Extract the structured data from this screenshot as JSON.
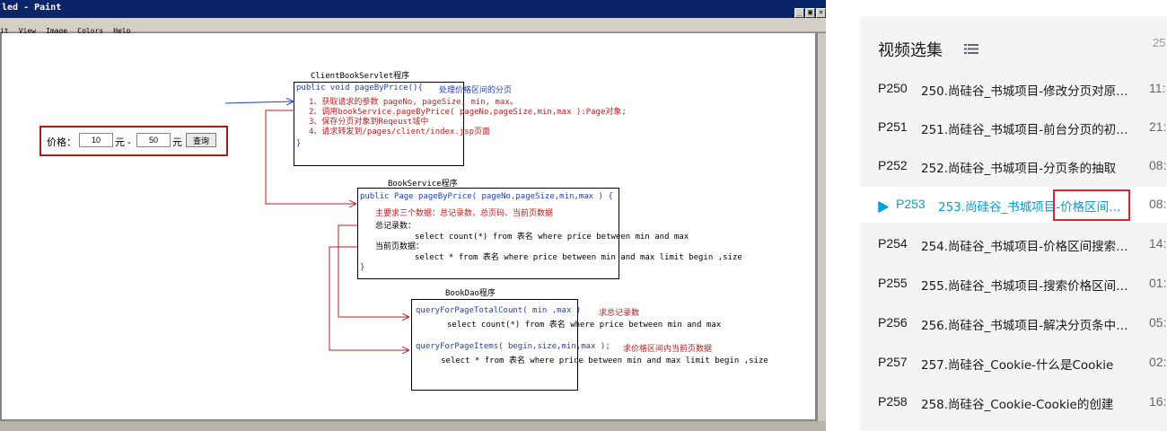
{
  "paint": {
    "title": "led - Paint",
    "menu": [
      "it",
      "View",
      "Image",
      "Colors",
      "Help"
    ],
    "window_buttons": [
      "_",
      "▣",
      "×"
    ]
  },
  "diagram": {
    "price_filter": {
      "label": "价格：",
      "min_value": "10",
      "unit1": "元 -",
      "max_value": "50",
      "unit2": "元",
      "button": "查询"
    },
    "servlet": {
      "heading": "ClientBookServlet程序",
      "signature": "public void pageByPrice(){",
      "comment": "处理价格区间的分页",
      "steps": [
        "1、获取请求的参数 pageNo, pageSize, min, max。",
        "2、调用bookService.pageByPrice( pageNo,pageSize,min,max ):Page对象;",
        "3、保存分页对象到Reqeust域中",
        "4、请求转发到/pages/client/index.jsp页面"
      ],
      "close": "}"
    },
    "service": {
      "heading": "BookService程序",
      "signature": "public Page pageByPrice( pageNo,pageSize,min,max ) {",
      "note": "主要求三个数据：总记录数、总页码、当前页数据",
      "total_label": "总记录数：",
      "total_sql": "select count(*) from 表名 where price between min and max",
      "page_label": "当前页数据：",
      "page_sql": "select * from 表名 where price between min and max limit begin ,size",
      "close": "}"
    },
    "dao": {
      "heading": "BookDao程序",
      "m1_sig": "queryForPageTotalCount( min ,max )",
      "m1_note": "求总记录数",
      "m1_sql": "select count(*) from 表名 where price between min and max",
      "m2_sig": "queryForPageItems( begin,size,min,max );",
      "m2_note": "求价格区间内当前页数据",
      "m2_sql": "select * from 表名 where price between min and max limit begin ,size"
    }
  },
  "panel": {
    "title": "视频选集",
    "count": "25",
    "episodes": [
      {
        "code": "P250",
        "name": "250.尚硅谷_书城项目-修改分页对原…",
        "dur": "11:"
      },
      {
        "code": "P251",
        "name": "251.尚硅谷_书城项目-前台分页的初…",
        "dur": "21:"
      },
      {
        "code": "P252",
        "name": "252.尚硅谷_书城项目-分页条的抽取",
        "dur": "08:"
      },
      {
        "code": "P253",
        "name": "253.尚硅谷_书城项目-价格区间…",
        "dur": "08:"
      },
      {
        "code": "P254",
        "name": "254.尚硅谷_书城项目-价格区间搜索…",
        "dur": "14:"
      },
      {
        "code": "P255",
        "name": "255.尚硅谷_书城项目-搜索价格区间…",
        "dur": "01:"
      },
      {
        "code": "P256",
        "name": "256.尚硅谷_书城项目-解决分页条中…",
        "dur": "05:"
      },
      {
        "code": "P257",
        "name": "257.尚硅谷_Cookie-什么是Cookie",
        "dur": "02:"
      },
      {
        "code": "P258",
        "name": "258.尚硅谷_Cookie-Cookie的创建",
        "dur": "16:"
      }
    ],
    "active_index": 3,
    "colors": {
      "active": "#00a1d6",
      "highlight": "#e0232e"
    }
  }
}
